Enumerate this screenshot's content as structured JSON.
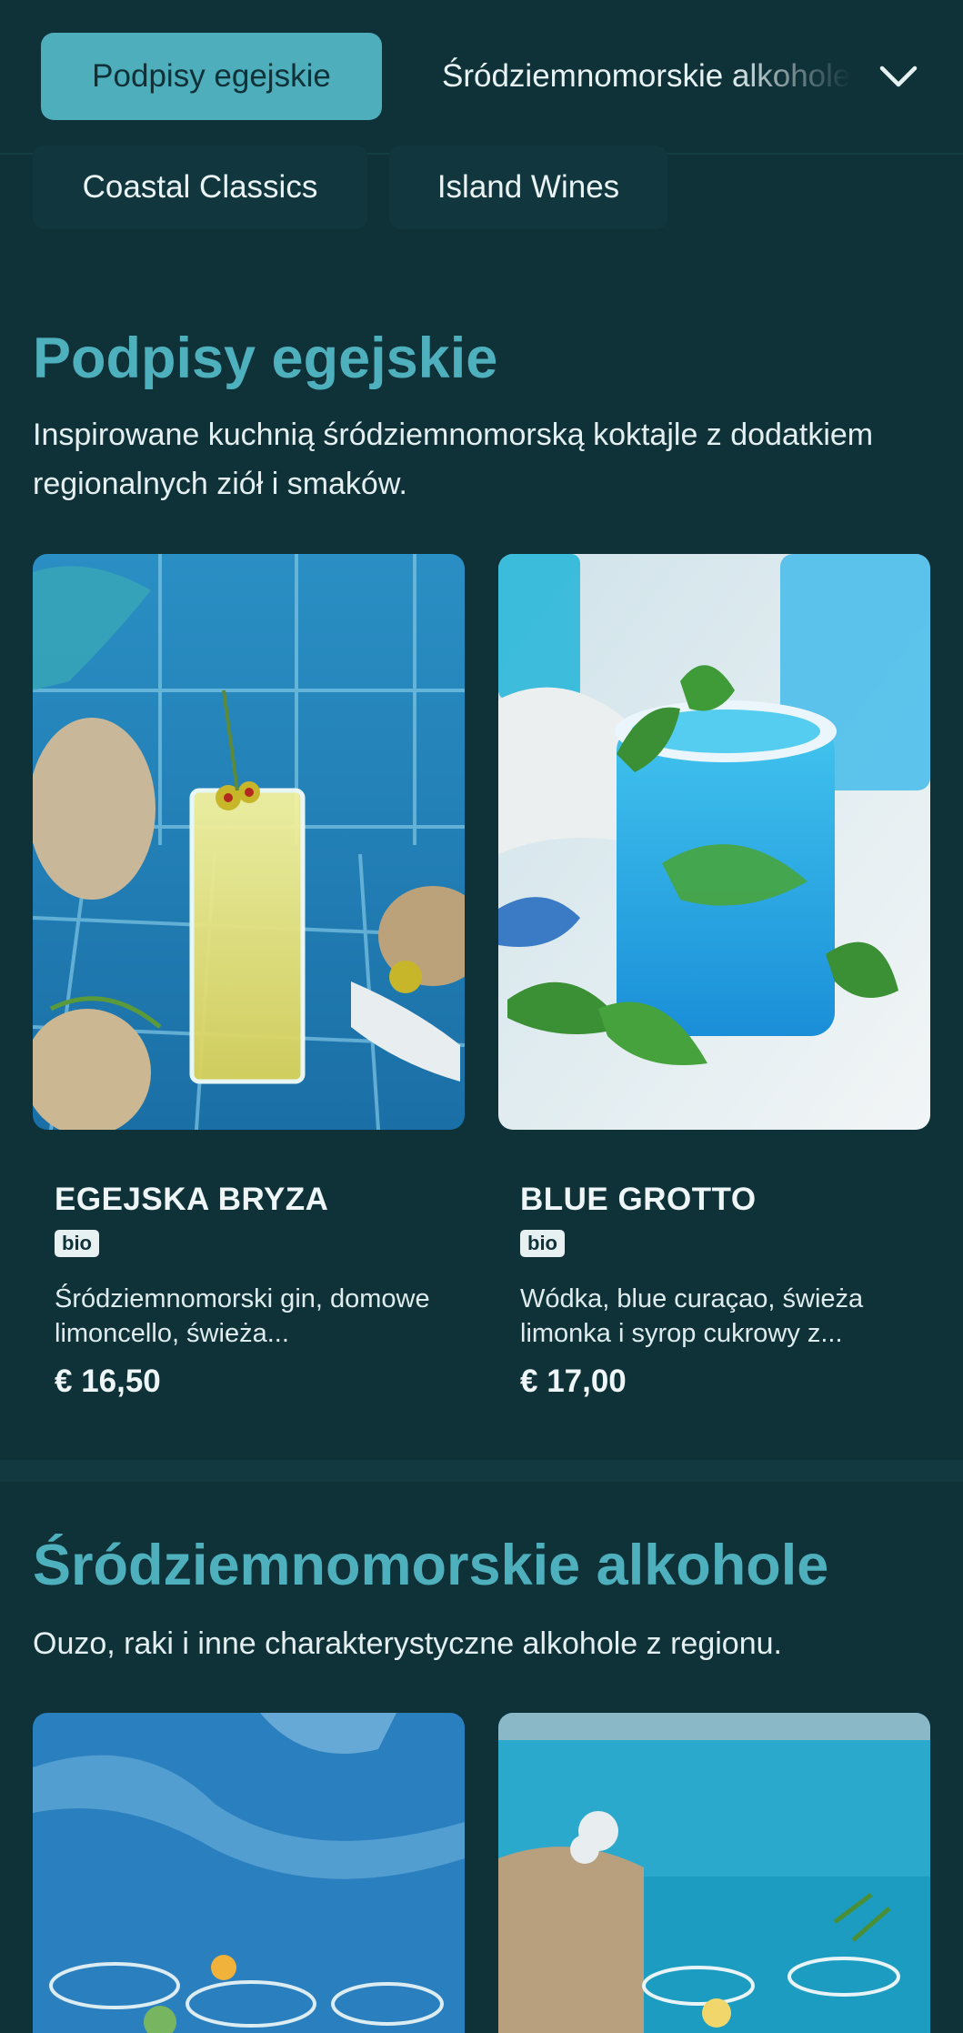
{
  "categories": {
    "active": "Podpisy egejskie",
    "next": "Śródziemnomorskie alkohole",
    "expand_icon": "chevron-down-icon"
  },
  "subtabs": [
    "Coastal Classics",
    "Island Wines"
  ],
  "sections": [
    {
      "title": "Podpisy egejskie",
      "description": "Inspirowane kuchnią śródziemnomorską koktajle z dodatkiem regionalnych ziół i smaków.",
      "items": [
        {
          "name": "EGEJSKA BRYZA",
          "badge": "bio",
          "description": "Śródziemnomorski gin, domowe limoncello, świeża...",
          "price": "€ 16,50"
        },
        {
          "name": "BLUE GROTTO",
          "badge": "bio",
          "description": "Wódka, blue curaçao, świeża limonka i syrop cukrowy z...",
          "price": "€ 17,00"
        }
      ]
    },
    {
      "title": "Śródziemnomorskie alkohole",
      "description": "Ouzo, raki i inne charakterystyczne alkohole z regionu."
    }
  ],
  "colors": {
    "background": "#0f3138",
    "accent": "#4eaebb",
    "text": "#e6f1f2"
  }
}
